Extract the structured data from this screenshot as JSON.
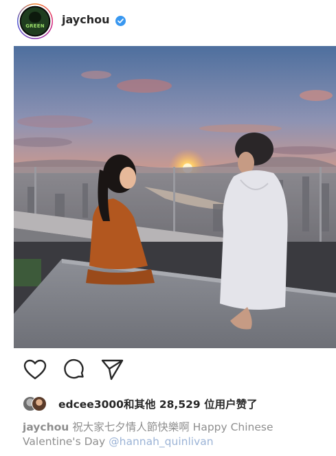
{
  "post": {
    "username": "jaychou",
    "verified": true,
    "avatar_badge": "GREEN"
  },
  "actions": {
    "like_icon": "heart-icon",
    "comment_icon": "comment-icon",
    "share_icon": "share-icon"
  },
  "likes": {
    "text": "edcee3000和其他 28,529 位用户赞了"
  },
  "caption": {
    "user": "jaychou",
    "text_line1": "祝大家七夕情人節快樂啊 Happy Chinese",
    "text_line2": "Valentine's Day",
    "mention": "@hannah_quinlivan"
  },
  "colors": {
    "verified": "#3897f0",
    "text": "#262626",
    "muted": "#8e8e8e",
    "mention": "#9bb3d6"
  }
}
